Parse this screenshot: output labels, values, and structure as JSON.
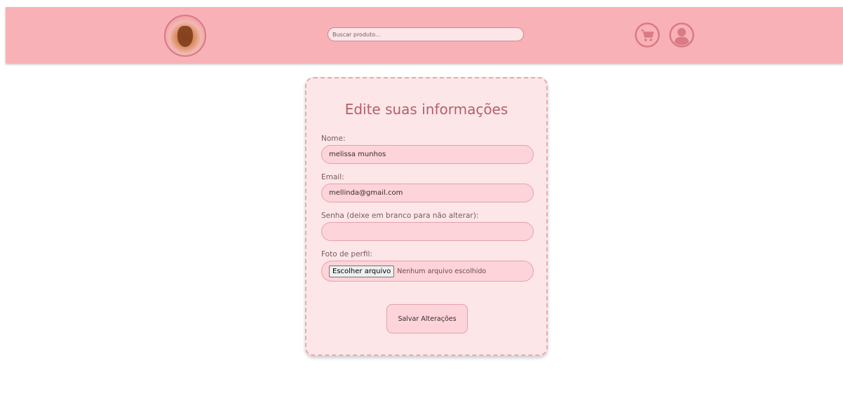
{
  "header": {
    "search_placeholder": "Buscar produto...",
    "logo_icon": "ice-cream-logo",
    "cart_icon": "cart-icon",
    "user_icon": "user-icon"
  },
  "form": {
    "title": "Edite suas informações",
    "name_label": "Nome:",
    "name_value": "melissa munhos",
    "email_label": "Email:",
    "email_value": "mellinda@gmail.com",
    "password_label": "Senha (deixe em branco para não alterar):",
    "password_value": "",
    "photo_label": "Foto de perfil:",
    "file_button_label": "Escolher arquivo",
    "file_status": "Nenhum arquivo escolhido",
    "save_label": "Salvar Alterações"
  },
  "colors": {
    "header_bg": "#f8b1b7",
    "card_bg": "#fde6e8",
    "field_bg": "#fcd4da",
    "title_color": "#b35f68",
    "icon_color": "#d97a84"
  }
}
